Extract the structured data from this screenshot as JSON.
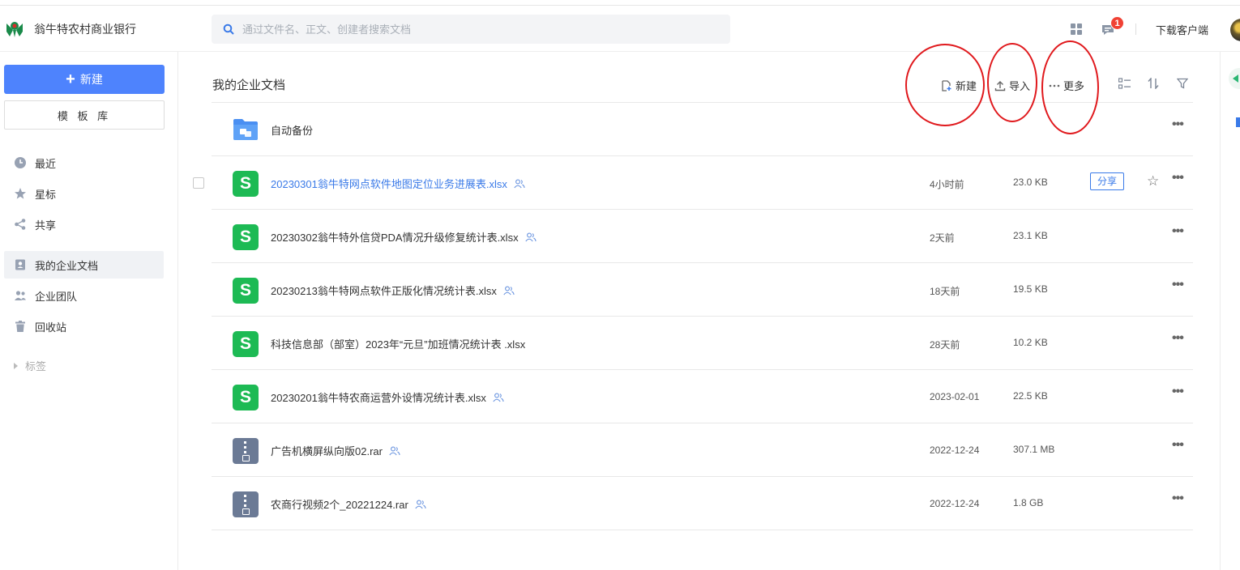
{
  "header": {
    "brand_name": "翁牛特农村商业银行",
    "search_placeholder": "通过文件名、正文、创建者搜索文档",
    "notification_count": "1",
    "download_client": "下载客户端"
  },
  "sidebar": {
    "new_button": "新建",
    "template_button": "模 板 库",
    "items": [
      {
        "label": "最近",
        "icon": "clock-icon"
      },
      {
        "label": "星标",
        "icon": "star-icon"
      },
      {
        "label": "共享",
        "icon": "share-icon"
      },
      {
        "label": "我的企业文档",
        "icon": "user-doc-icon",
        "active": true
      },
      {
        "label": "企业团队",
        "icon": "team-icon"
      },
      {
        "label": "回收站",
        "icon": "trash-icon"
      }
    ],
    "tags_label": "标签"
  },
  "main": {
    "title": "我的企业文档",
    "toolbar": {
      "new_label": "新建",
      "import_label": "导入",
      "more_label": "更多"
    },
    "files": [
      {
        "name": "自动备份",
        "type": "folder",
        "time": "",
        "size": ""
      },
      {
        "name": "20230301翁牛特网点软件地图定位业务进展表.xlsx",
        "type": "xlsx",
        "time": "4小时前",
        "size": "23.0 KB",
        "share_label": "分享",
        "highlighted": true
      },
      {
        "name": "20230302翁牛特外信贷PDA情况升级修复统计表.xlsx",
        "type": "xlsx",
        "time": "2天前",
        "size": "23.1 KB"
      },
      {
        "name": "20230213翁牛特网点软件正版化情况统计表.xlsx",
        "type": "xlsx",
        "time": "18天前",
        "size": "19.5 KB"
      },
      {
        "name": "科技信息部（部室）2023年“元旦”加班情况统计表 .xlsx",
        "type": "xlsx",
        "time": "28天前",
        "size": "10.2 KB"
      },
      {
        "name": "20230201翁牛特农商运营外设情况统计表.xlsx",
        "type": "xlsx",
        "time": "2023-02-01",
        "size": "22.5 KB"
      },
      {
        "name": "广告机横屏纵向版02.rar",
        "type": "rar",
        "time": "2022-12-24",
        "size": "307.1 MB"
      },
      {
        "name": "农商行视频2个_20221224.rar",
        "type": "rar",
        "time": "2022-12-24",
        "size": "1.8 GB"
      }
    ],
    "xls_glyph": "S",
    "more_glyph": "•••",
    "star_glyph": "☆"
  },
  "colors": {
    "accent": "#4e83fd",
    "link": "#3a7ae8",
    "xls_green": "#1dba54",
    "annotation_red": "#e0191d"
  }
}
